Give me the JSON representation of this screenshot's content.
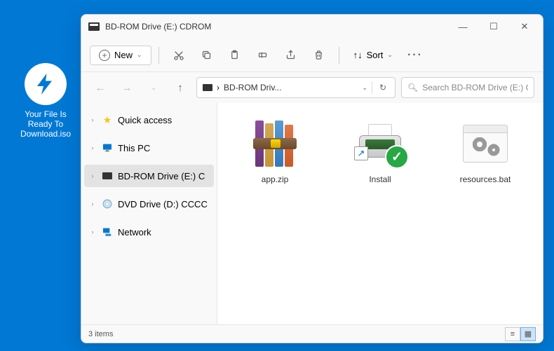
{
  "desktop": {
    "icon_label_line1": "Your File Is",
    "icon_label_line2": "Ready To",
    "icon_label_line3": "Download.iso"
  },
  "window": {
    "title": "BD-ROM Drive (E:) CDROM"
  },
  "toolbar": {
    "new_label": "New",
    "sort_label": "Sort"
  },
  "address": {
    "path": "BD-ROM Driv...",
    "search_placeholder": "Search BD-ROM Drive (E:) CD..."
  },
  "nav": {
    "items": [
      {
        "label": "Quick access",
        "icon": "⭐",
        "color": "#f5c518"
      },
      {
        "label": "This PC",
        "icon": "🖥",
        "color": "#0078d4"
      },
      {
        "label": "BD-ROM Drive (E:) C",
        "icon": "disc",
        "selected": true
      },
      {
        "label": "DVD Drive (D:) CCCC",
        "icon": "💿",
        "color": "#0078d4"
      },
      {
        "label": "Network",
        "icon": "🖥",
        "color": "#0078d4"
      }
    ]
  },
  "files": {
    "items": [
      {
        "name": "app.zip"
      },
      {
        "name": "Install"
      },
      {
        "name": "resources.bat"
      }
    ]
  },
  "status": {
    "text": "3 items"
  }
}
